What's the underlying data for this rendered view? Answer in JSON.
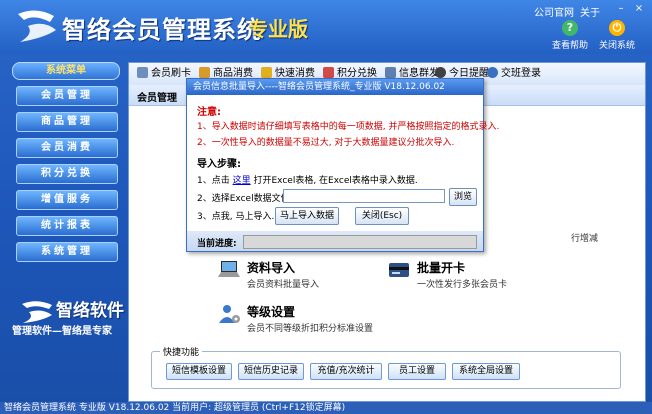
{
  "app": {
    "title": "智络会员管理系统",
    "edition": "专业版"
  },
  "header": {
    "links": [
      "公司官网",
      "关于"
    ],
    "window_controls": [
      "–",
      "×"
    ],
    "buttons": [
      {
        "label": "查看帮助",
        "icon": "help-icon"
      },
      {
        "label": "关闭系统",
        "icon": "power-icon"
      }
    ]
  },
  "sidebar": {
    "heading": "系统菜单",
    "items": [
      {
        "label": "会员管理"
      },
      {
        "label": "商品管理"
      },
      {
        "label": "会员消费"
      },
      {
        "label": "积分兑换"
      },
      {
        "label": "增值服务"
      },
      {
        "label": "统计报表"
      },
      {
        "label": "系统管理"
      }
    ],
    "brand_name": "智络软件",
    "brand_slogan": "管理软件—智络是专家"
  },
  "toolbar": {
    "items": [
      {
        "label": "会员刷卡",
        "icon": "card-icon"
      },
      {
        "label": "商品消费",
        "icon": "cart-icon"
      },
      {
        "label": "快速消费",
        "icon": "lightning-icon"
      },
      {
        "label": "积分兑换",
        "icon": "gift-icon"
      },
      {
        "label": "信息群发",
        "icon": "message-icon"
      },
      {
        "label": "今日提醒",
        "icon": "clock-icon"
      },
      {
        "label": "交班登录",
        "icon": "user-icon"
      }
    ]
  },
  "main": {
    "section_tab": "会员管理",
    "partial_text": "行增减",
    "features": [
      {
        "title": "资料导入",
        "desc": "会员资料批量导入",
        "icon": "laptop-icon"
      },
      {
        "title": "批量开卡",
        "desc": "一次性发行多张会员卡",
        "icon": "card-icon"
      },
      {
        "title": "等级设置",
        "desc": "会员不同等级折扣积分标准设置",
        "icon": "user-settings-icon"
      }
    ],
    "quick": {
      "legend": "快捷功能",
      "buttons": [
        "短信模板设置",
        "短信历史记录",
        "充值/充次统计",
        "员工设置",
        "系统全局设置"
      ]
    }
  },
  "dialog": {
    "title": "会员信息批量导入----智络会员管理系统_专业版 V18.12.06.02",
    "note_heading": "注意:",
    "notes": [
      "1、导入数据时请仔细填写表格中的每一项数据, 并严格按照指定的格式录入.",
      "2、一次性导入的数据量不易过大, 对于大数据量建议分批次导入."
    ],
    "steps_heading": "导入步骤:",
    "step1_prefix": "1、点击",
    "step1_link": "这里",
    "step1_suffix": "打开Excel表格, 在Excel表格中录入数据.",
    "step2_label": "2、选择Excel数据文件:",
    "file_value": "",
    "browse_label": "浏览",
    "step3_label": "3、点我, 马上导入.",
    "import_label": "马上导入数据",
    "close_label": "关闭(Esc)",
    "progress_label": "当前进度:",
    "progress_fraction": 0
  },
  "status_bar": {
    "text": "智络会员管理系统 专业版 V18.12.06.02 当前用户: 超级管理员 (Ctrl+F12锁定屏幕)"
  }
}
